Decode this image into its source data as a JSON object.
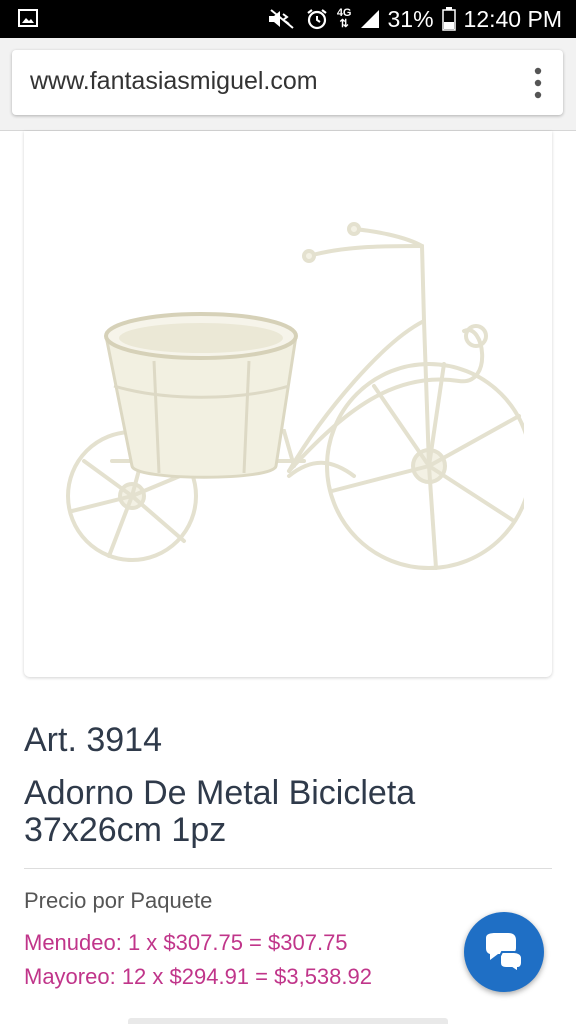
{
  "status_bar": {
    "battery_percent": "31%",
    "time": "12:40 PM",
    "network": "4G",
    "icons": [
      "gallery-icon",
      "mute-icon",
      "alarm-icon",
      "4g-icon",
      "signal-icon",
      "battery-icon"
    ]
  },
  "browser": {
    "url": "www.fantasiasmiguel.com",
    "menu_icon": "more-vert-icon"
  },
  "product": {
    "art_number": "Art. 3914",
    "title": "Adorno De Metal Bicicleta 37x26cm 1pz",
    "image": "bicycle-planter-image"
  },
  "pricing": {
    "label": "Precio por Paquete",
    "retail": "Menudeo: 1 x $307.75 = $307.75",
    "wholesale": "Mayoreo: 12 x $294.91 = $3,538.92"
  },
  "chat": {
    "icon": "chat-bubbles-icon",
    "color": "#1f6fc5"
  },
  "colors": {
    "price_text": "#c0358a",
    "heading_text": "#2f3a4a"
  }
}
